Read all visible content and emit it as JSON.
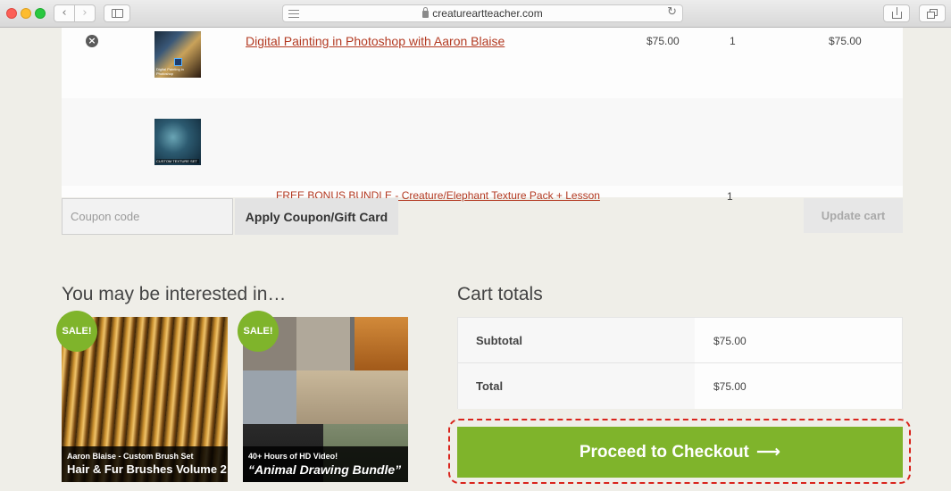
{
  "browser": {
    "url": "creatureartteacher.com",
    "back_glyph": "‹",
    "forward_glyph": "›",
    "reload_glyph": "↻"
  },
  "cart": {
    "remove_glyph": "×",
    "items": [
      {
        "name": "Digital Painting in Photoshop with Aaron Blaise",
        "price": "$75.00",
        "quantity": "1",
        "subtotal": "$75.00",
        "thumbnail_icon": "digital-painting-thumbnail",
        "thumbnail_caption": "Digital Painting in Photoshop"
      },
      {
        "name": "FREE BONUS BUNDLE - Creature/Elephant Texture Pack + Lesson",
        "quantity": "1",
        "thumbnail_icon": "texture-pack-thumbnail",
        "thumbnail_caption": "CUSTOM TEXTURE SET"
      }
    ],
    "coupon_placeholder": "Coupon code",
    "apply_coupon_label": "Apply Coupon/Gift Card",
    "update_cart_label": "Update cart"
  },
  "cross_sells": {
    "heading": "You may be interested in…",
    "products": [
      {
        "badge": "SALE!",
        "caption_small": "Aaron Blaise - Custom Brush Set",
        "caption_big": "Hair & Fur Brushes Volume 2"
      },
      {
        "badge": "SALE!",
        "caption_small": "40+ Hours of HD Video!",
        "caption_big": "“Animal Drawing Bundle”"
      }
    ]
  },
  "totals": {
    "heading": "Cart totals",
    "subtotal_label": "Subtotal",
    "subtotal_value": "$75.00",
    "total_label": "Total",
    "total_value": "$75.00",
    "checkout_label": "Proceed to Checkout",
    "checkout_arrow": "⟶"
  },
  "colors": {
    "accent_green": "#7fb42b",
    "link_red": "#b33a22",
    "highlight_red": "#d9241c",
    "page_background": "#efeee8"
  }
}
